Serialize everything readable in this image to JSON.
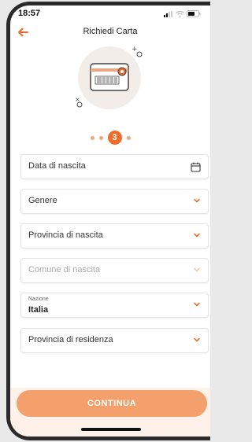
{
  "status": {
    "time": "18:57"
  },
  "header": {
    "title": "Richiedi Carta"
  },
  "stepper": {
    "active_step": "3"
  },
  "form": {
    "birth_date": "Data di nascita",
    "gender": "Genere",
    "birth_province": "Provincia di nascita",
    "birth_municipality": "Comune di nascita",
    "nation_label": "Nazione",
    "nation_value": "Italia",
    "residence_province": "Provincia di residenza"
  },
  "footer": {
    "continue_label": "CONTINUA"
  },
  "colors": {
    "accent": "#ef6d2a",
    "button": "#f4a06d",
    "footer_bg": "#fdf1e9"
  },
  "icons": [
    "back-arrow-icon",
    "calendar-icon",
    "chevron-down-icon",
    "signal-icon",
    "wifi-icon",
    "battery-icon"
  ]
}
